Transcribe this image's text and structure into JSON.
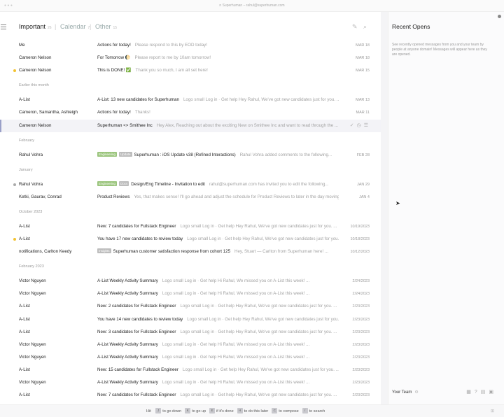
{
  "titlebar": {
    "text": "n Superhuman – rahul@superhuman.com"
  },
  "tabs": [
    {
      "label": "Important",
      "count": "26",
      "active": true
    },
    {
      "label": "Calendar",
      "count": "7",
      "active": false
    },
    {
      "label": "Other",
      "count": "15",
      "active": false
    }
  ],
  "colors": {
    "dot_gray": "#aaaaaa",
    "dot_yellow": "#f2c230",
    "label_green": "#9bc57d",
    "label_gray": "#bdbdbd"
  },
  "sections": [
    {
      "id": "s1",
      "label": "Earlier this month"
    },
    {
      "id": "s2",
      "label": "February"
    },
    {
      "id": "s3",
      "label": "January"
    },
    {
      "id": "s4",
      "label": "October 2023"
    },
    {
      "id": "s5",
      "label": "February 2023"
    }
  ],
  "emails": [
    {
      "sender": "Me",
      "subject": "Actions for today!",
      "snippet": "Please respond to this by EOD today!",
      "date": "MAR 18"
    },
    {
      "sender": "Cameron Nelson",
      "subject": "For Tomorrow 🌔",
      "snippet": "Please report to me by 10am tomorrow!",
      "date": "MAR 18"
    },
    {
      "sender": "Cameron Nelson",
      "subject": "This is DONE! ✅",
      "snippet": "Thank you so much, I am all set here!",
      "date": "MAR 15"
    },
    {
      "sender": "A-List",
      "subject": "A-List: 13 new candidates for Superhuman",
      "snippet": "Logo small Log in · Get help Hey Rahul, We've got new candidates just for you. ...",
      "date": "MAR 13"
    },
    {
      "sender": "Cameron, Samantha, Ashleigh",
      "subject": "Actions for today!",
      "snippet": "Thanks!",
      "date": "MAR 11"
    },
    {
      "sender": "Cameron Nelson",
      "subject": "Superhuman <> Smithee Inc",
      "snippet": "Hey Alex, Reaching out about the exciting New on Smithee Inc and want to read through the ...",
      "date": ""
    },
    {
      "sender": "Rahul Vohra",
      "label1": "Engineering",
      "label2": "Update",
      "subject": "Superhuman : iOS Update v38 (Refined Interactions)",
      "snippet": "Rahul Vohra added comments to the following...",
      "date": "FEB 28"
    },
    {
      "sender": "Rahul Vohra",
      "label1": "Engineering",
      "label2": "Docs",
      "subject": "Design/Eng Timeline - Invitation to edit",
      "snippet": "rahul@superhuman.com has invited you to edit the following...",
      "date": "JAN 29"
    },
    {
      "sender": "Ketki, Gaurav, Conrad",
      "subject": "Product Reviews",
      "snippet": "Yes, that makes sense! I'll go ahead and adjust the schedule for Product Reviews to later in the day moving...",
      "date": "JAN 4"
    },
    {
      "sender": "A-List",
      "subject": "New: 7 candidates for Fullstack Engineer",
      "snippet": "Logo small Log in · Get help Hey Rahul, We've got new candidates just for you. ...",
      "date": "10/19/2023"
    },
    {
      "sender": "A-List",
      "subject": "You have 17 new candidates to review today",
      "snippet": "Logo small Log in · Get help Hey Rahul, We've got new candidates just for you. ...",
      "date": "10/18/2023"
    },
    {
      "sender": "notifications, Carlton Keedy",
      "label1": "Insights",
      "subject": "Superhuman customer satisfaction response from cohort 125",
      "snippet": "Hey, Stuart — Carlton from Superhuman here! ...",
      "date": "10/12/2023"
    },
    {
      "sender": "Victor Nguyen",
      "subject": "A-List Weekly Activity Summary",
      "snippet": "Logo small Log in · Get help Hi Rahul, We missed you on A-List this week! ...",
      "date": "2/24/2023"
    },
    {
      "sender": "Victor Nguyen",
      "subject": "A-List Weekly Activity Summary",
      "snippet": "Logo small Log in · Get help Hi Rahul, We missed you on A-List this week! ...",
      "date": "2/24/2023"
    },
    {
      "sender": "A-List",
      "subject": "New: 2 candidates for Fullstack Engineer",
      "snippet": "Logo small Log in · Get help Hey Rahul, We've got new candidates just for you. ...",
      "date": "2/23/2023"
    },
    {
      "sender": "A-List",
      "subject": "You have 14 new candidates to review today",
      "snippet": "Logo small Log in · Get help Hey Rahul, We've got new candidates just for you. ...",
      "date": "2/23/2023"
    },
    {
      "sender": "A-List",
      "subject": "New: 3 candidates for Fullstack Engineer",
      "snippet": "Logo small Log in · Get help Hey Rahul, We've got new candidates just for you. ...",
      "date": "2/23/2023"
    },
    {
      "sender": "Victor Nguyen",
      "subject": "A-List Weekly Activity Summary",
      "snippet": "Logo small Log in · Get help Hi Rahul, We missed you on A-List this week! ...",
      "date": "2/23/2023"
    },
    {
      "sender": "Victor Nguyen",
      "subject": "A-List Weekly Activity Summary",
      "snippet": "Logo small Log in · Get help Hi Rahul, We missed you on A-List this week! ...",
      "date": "2/23/2023"
    },
    {
      "sender": "A-List",
      "subject": "New: 15 candidates for Fullstack Engineer",
      "snippet": "Logo small Log in · Get help Hey Rahul, We've got new candidates just for you. ...",
      "date": "2/23/2023"
    },
    {
      "sender": "Victor Nguyen",
      "subject": "A-List Weekly Activity Summary",
      "snippet": "Logo small Log in · Get help Hi Rahul, We missed you on A-List this week! ...",
      "date": "2/23/2023"
    },
    {
      "sender": "A-List",
      "subject": "New: 7 candidates for Fullstack Engineer",
      "snippet": "Logo small Log in · Get help Hey Rahul, We've got new candidates just for you. ...",
      "date": "2/23/2023"
    }
  ],
  "right_panel": {
    "title": "Recent Opens",
    "description": "See recently opened messages from you and your team by people at anyone domain! Messages will appear here as they are opened.",
    "team_label": "Your Team"
  },
  "footer": {
    "hint": "Hit",
    "shortcuts": [
      {
        "key": "J",
        "text": "to go down"
      },
      {
        "key": "K",
        "text": "to go up"
      },
      {
        "key": "E",
        "text": "if it's done"
      },
      {
        "key": "H",
        "text": "to do this later"
      },
      {
        "key": "C",
        "text": "to compose"
      },
      {
        "key": "/",
        "text": "to search"
      }
    ]
  }
}
